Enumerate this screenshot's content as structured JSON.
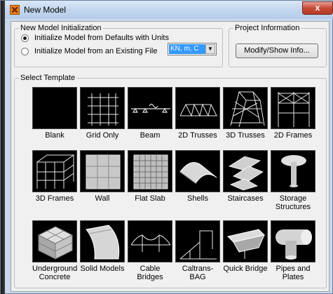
{
  "window": {
    "title": "New Model",
    "close_glyph": "x"
  },
  "init": {
    "group_label": "New Model Initialization",
    "option_defaults": "Initialize Model from Defaults with Units",
    "option_existing": "Initialize Model  from an Existing File",
    "units_value": "KN, m, C",
    "selected_option": "defaults"
  },
  "project": {
    "group_label": "Project Information",
    "button_label": "Modify/Show Info..."
  },
  "templates": {
    "group_label": "Select Template",
    "items": [
      {
        "label": "Blank",
        "icon": "blank-icon"
      },
      {
        "label": "Grid Only",
        "icon": "grid-only-icon"
      },
      {
        "label": "Beam",
        "icon": "beam-icon"
      },
      {
        "label": "2D Trusses",
        "icon": "2d-trusses-icon"
      },
      {
        "label": "3D Trusses",
        "icon": "3d-trusses-icon"
      },
      {
        "label": "2D Frames",
        "icon": "2d-frames-icon"
      },
      {
        "label": "3D Frames",
        "icon": "3d-frames-icon"
      },
      {
        "label": "Wall",
        "icon": "wall-icon"
      },
      {
        "label": "Flat Slab",
        "icon": "flat-slab-icon"
      },
      {
        "label": "Shells",
        "icon": "shells-icon"
      },
      {
        "label": "Staircases",
        "icon": "staircases-icon"
      },
      {
        "label": "Storage Structures",
        "icon": "storage-structures-icon"
      },
      {
        "label": "Underground Concrete",
        "icon": "underground-concrete-icon"
      },
      {
        "label": "Solid Models",
        "icon": "solid-models-icon"
      },
      {
        "label": "Cable Bridges",
        "icon": "cable-bridges-icon"
      },
      {
        "label": "Caltrans-BAG",
        "icon": "caltrans-bag-icon"
      },
      {
        "label": "Quick Bridge",
        "icon": "quick-bridge-icon"
      },
      {
        "label": "Pipes and Plates",
        "icon": "pipes-and-plates-icon"
      }
    ]
  }
}
